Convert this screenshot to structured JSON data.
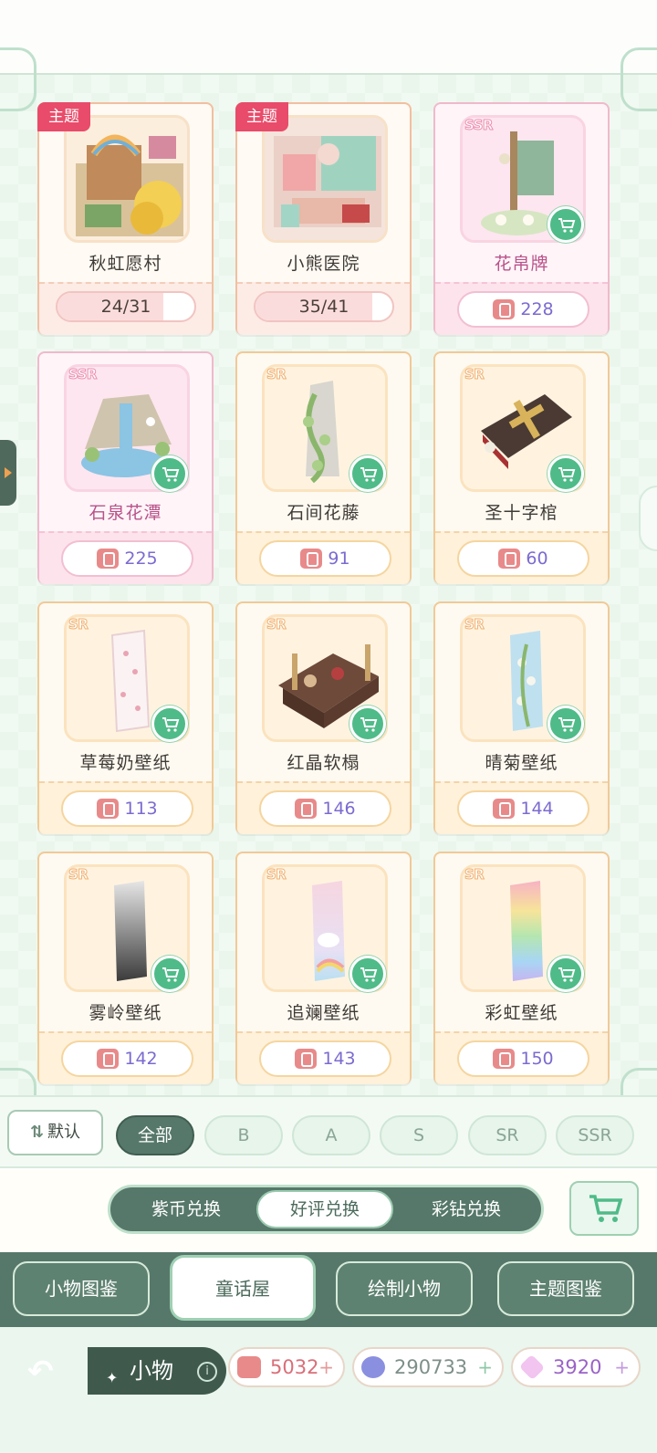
{
  "cards": [
    {
      "name": "秋虹愿村",
      "tag": "主题",
      "progress_text": "24/31",
      "progress": 0.774
    },
    {
      "name": "小熊医院",
      "tag": "主题",
      "progress_text": "35/41",
      "progress": 0.854
    },
    {
      "name": "花帛牌",
      "rarity": "SSR",
      "likes": "228"
    },
    {
      "name": "石泉花潭",
      "rarity": "SSR",
      "likes": "225"
    },
    {
      "name": "石间花藤",
      "rarity": "SR",
      "likes": "91"
    },
    {
      "name": "圣十字棺",
      "rarity": "SR",
      "likes": "60"
    },
    {
      "name": "草莓奶壁纸",
      "rarity": "SR",
      "likes": "113"
    },
    {
      "name": "红晶软榻",
      "rarity": "SR",
      "likes": "146"
    },
    {
      "name": "晴菊壁纸",
      "rarity": "SR",
      "likes": "144"
    },
    {
      "name": "雾岭壁纸",
      "rarity": "SR",
      "likes": "142"
    },
    {
      "name": "追斓壁纸",
      "rarity": "SR",
      "likes": "143"
    },
    {
      "name": "彩虹壁纸",
      "rarity": "SR",
      "likes": "150"
    }
  ],
  "filter": {
    "sort_label": "默认",
    "chips": [
      "全部",
      "B",
      "A",
      "S",
      "SR",
      "SSR"
    ],
    "active_chip": "全部"
  },
  "currency_tabs": [
    "紫币兑换",
    "好评兑换",
    "彩钻兑换"
  ],
  "active_currency_tab": "好评兑换",
  "main_tabs": [
    "小物图鉴",
    "童话屋",
    "绘制小物",
    "主题图鉴"
  ],
  "active_main_tab": "童话屋",
  "bottom": {
    "section_title": "小物",
    "balances": [
      {
        "icon": "thumbs-up-icon",
        "value": "5032",
        "color": "#d96f79"
      },
      {
        "icon": "purple-coin-icon",
        "value": "290733",
        "color": "#7d8f88"
      },
      {
        "icon": "diamond-icon",
        "value": "3920",
        "color": "#9a63c7"
      }
    ]
  },
  "colors": {
    "accent_green": "#56786a",
    "cart_green": "#4fbb88",
    "like_purple": "#7b6bd0",
    "theme_tag_red": "#e94b6a"
  }
}
